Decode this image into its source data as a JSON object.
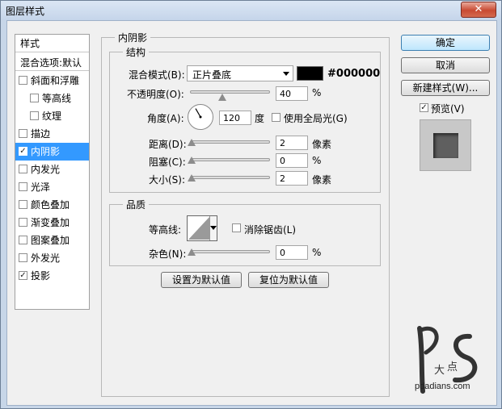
{
  "window": {
    "title": "图层样式",
    "close_glyph": "✕"
  },
  "style_list": {
    "header": "样式",
    "blend_options": "混合选项:默认",
    "items": [
      {
        "label": "斜面和浮雕",
        "checked": false,
        "indent": false
      },
      {
        "label": "等高线",
        "checked": false,
        "indent": true
      },
      {
        "label": "纹理",
        "checked": false,
        "indent": true
      },
      {
        "label": "描边",
        "checked": false,
        "indent": false
      },
      {
        "label": "内阴影",
        "checked": true,
        "indent": false,
        "selected": true
      },
      {
        "label": "内发光",
        "checked": false,
        "indent": false
      },
      {
        "label": "光泽",
        "checked": false,
        "indent": false
      },
      {
        "label": "颜色叠加",
        "checked": false,
        "indent": false
      },
      {
        "label": "渐变叠加",
        "checked": false,
        "indent": false
      },
      {
        "label": "图案叠加",
        "checked": false,
        "indent": false
      },
      {
        "label": "外发光",
        "checked": false,
        "indent": false
      },
      {
        "label": "投影",
        "checked": true,
        "indent": false
      }
    ]
  },
  "inner_shadow": {
    "title": "内阴影",
    "structure": {
      "title": "结构",
      "blend_mode_label": "混合模式(B):",
      "blend_mode_value": "正片叠底",
      "color_hex": "#000000",
      "opacity_label": "不透明度(O):",
      "opacity_value": "40",
      "opacity_unit": "%",
      "angle_label": "角度(A):",
      "angle_value": "120",
      "angle_unit": "度",
      "global_light_label": "使用全局光(G)",
      "distance_label": "距离(D):",
      "distance_value": "2",
      "distance_unit": "像素",
      "choke_label": "阻塞(C):",
      "choke_value": "0",
      "choke_unit": "%",
      "size_label": "大小(S):",
      "size_value": "2",
      "size_unit": "像素"
    },
    "quality": {
      "title": "品质",
      "contour_label": "等高线:",
      "anti_alias_label": "消除锯齿(L)",
      "noise_label": "杂色(N):",
      "noise_value": "0",
      "noise_unit": "%"
    },
    "make_default": "设置为默认值",
    "reset_default": "复位为默认值"
  },
  "buttons": {
    "ok": "确定",
    "cancel": "取消",
    "new_style": "新建样式(W)...",
    "preview_label": "预览(V)"
  },
  "watermark": {
    "site": "pdadians.com"
  }
}
